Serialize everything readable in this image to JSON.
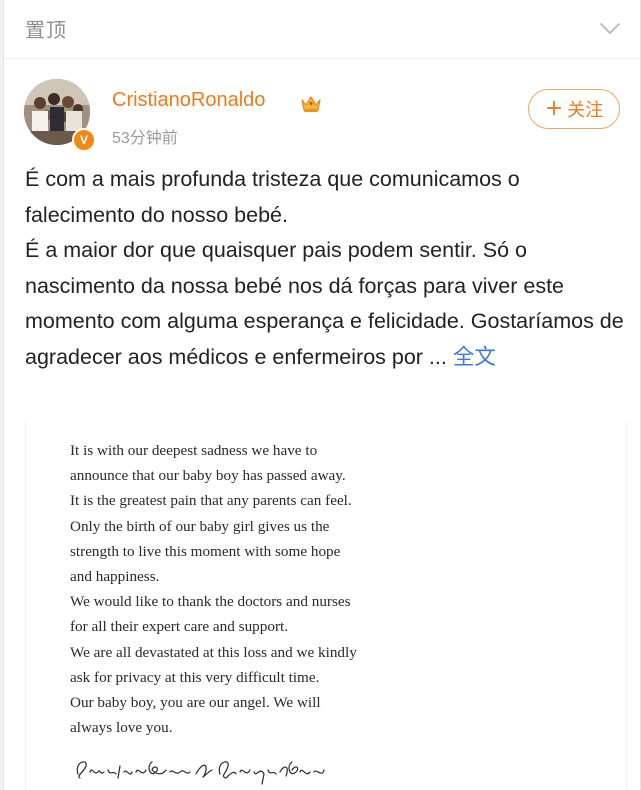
{
  "topbar": {
    "pin_label": "置顶",
    "collapse_icon": "chevron-down-icon"
  },
  "author": {
    "name": "CristianoRonaldo",
    "badge_icon": "crown-icon",
    "verified_icon": "verified-v-icon",
    "verified_mark": "V",
    "time": "53分钟前",
    "follow_label": "关注",
    "follow_plus": "+",
    "accent_color": "#f07a1a"
  },
  "post": {
    "paragraph1": "É com a mais profunda tristeza que comunicamos o falecimento do nosso bebé.",
    "paragraph2": "É a maior dor que quaisquer pais podem sentir. Só o nascimento da nossa bebé nos dá forças para viver este momento com alguma esperança e felicidade. Gostaríamos de agradecer aos médicos e enfermeiros por ...",
    "full_text_link": "全文",
    "link_color": "#3a7bd5"
  },
  "statement_image": {
    "lines": [
      "It is with our deepest sadness we have to",
      "announce that our baby boy has passed away.",
      "It is the greatest pain that any parents can feel.",
      "Only the birth of our baby girl gives us the",
      "strength to live this moment with some hope",
      "and happiness.",
      "We would like to thank the doctors and nurses",
      "for all their expert care and support.",
      "We are all devastated at this loss and we kindly",
      "ask for privacy at this very difficult time.",
      "Our baby boy, you are our angel. We will",
      "always love you."
    ],
    "signature": "Cristiano Ronaldo & Georgina Rodriguez"
  }
}
